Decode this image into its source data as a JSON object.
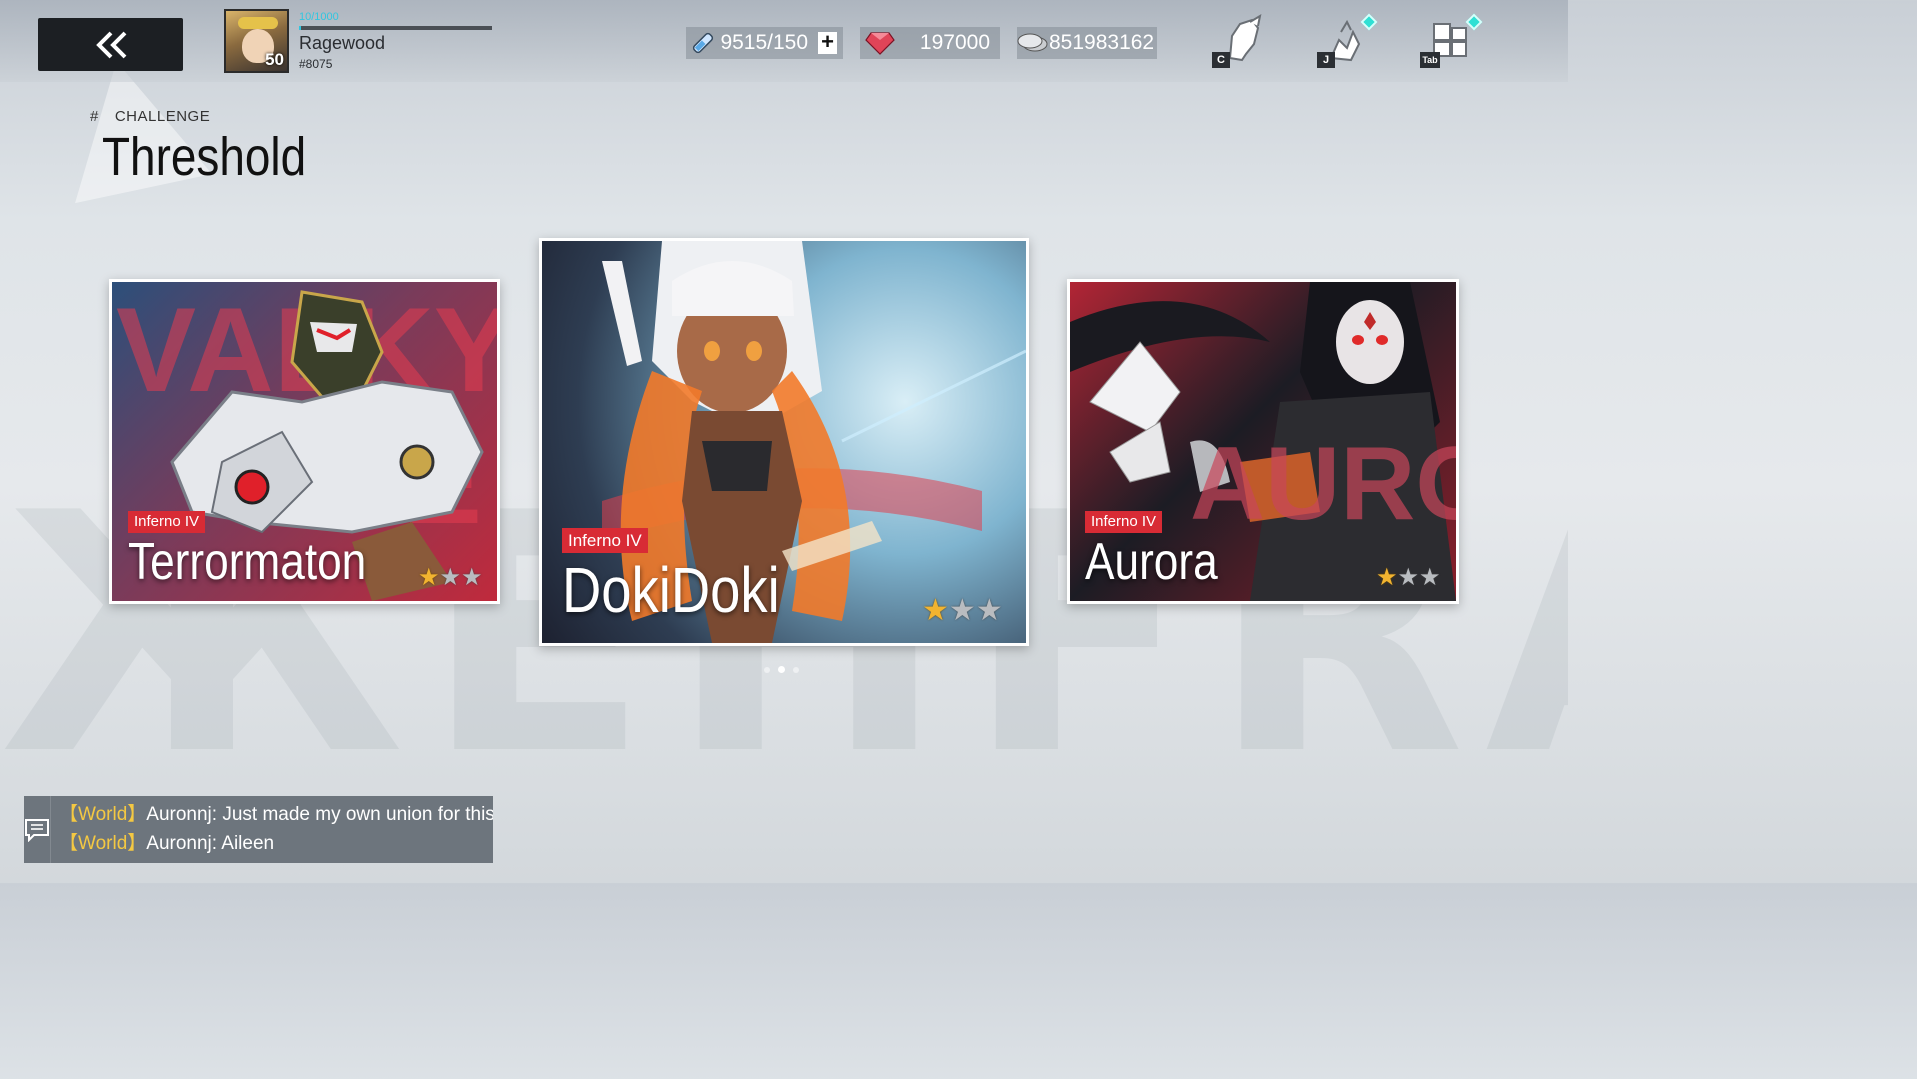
{
  "player": {
    "exp": "10/1000",
    "exp_fraction": 0.01,
    "name": "Ragewood",
    "id": "#8075",
    "level": "50"
  },
  "resources": {
    "stamina": "9515/150",
    "gems": "197000",
    "coins": "851983162"
  },
  "top_icons": [
    {
      "name": "character",
      "key": "C",
      "badge": false
    },
    {
      "name": "journey",
      "key": "J",
      "badge": true
    },
    {
      "name": "menu",
      "key": "Tab",
      "badge": true
    }
  ],
  "header": {
    "hash": "#",
    "category": "CHALLENGE",
    "title": "Threshold"
  },
  "cards": [
    {
      "difficulty": "Inferno IV",
      "name": "Terrormaton",
      "stars_earned": 1,
      "stars_total": 3,
      "bg_word": "VALKYR",
      "bg_word2": "E"
    },
    {
      "difficulty": "Inferno IV",
      "name": "DokiDoki",
      "stars_earned": 1,
      "stars_total": 3
    },
    {
      "difficulty": "Inferno IV",
      "name": "Aurora",
      "stars_earned": 1,
      "stars_total": 3,
      "bg_word": "AURORA"
    }
  ],
  "pager": {
    "count": 3,
    "active": 1
  },
  "chat": {
    "messages": [
      {
        "channel": "【World】",
        "text": "Auronnj: Just made my own union for this se"
      },
      {
        "channel": "【World】",
        "text": "Auronnj: Aileen"
      }
    ]
  },
  "colors": {
    "accent_cyan": "#31c6e0",
    "difficulty_red": "#d82b35",
    "star_gold": "#f2b430",
    "chat_channel": "#f4c842"
  }
}
